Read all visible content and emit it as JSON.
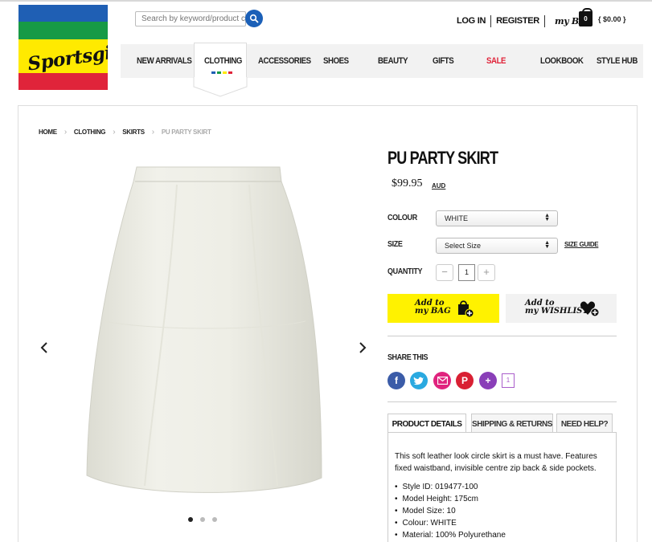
{
  "header": {
    "brand": "Sportsgirl",
    "search_placeholder": "Search by keyword/product code",
    "login": "LOG IN",
    "register": "REGISTER",
    "my_bag": "my BAG",
    "bag_count": "0",
    "bag_total": "{ $0.00 }"
  },
  "nav": {
    "items": [
      "NEW ARRIVALS",
      "CLOTHING",
      "ACCESSORIES",
      "SHOES",
      "BEAUTY",
      "GIFTS",
      "SALE",
      "LOOKBOOK",
      "STYLE HUB"
    ],
    "active": "CLOTHING",
    "sale_color": "#e0243a"
  },
  "breadcrumb": [
    "HOME",
    "CLOTHING",
    "SKIRTS",
    "PU PARTY SKIRT"
  ],
  "product": {
    "title": "PU PARTY SKIRT",
    "price": "$99.95",
    "currency": "AUD",
    "colour_label": "COLOUR",
    "colour_value": "WHITE",
    "size_label": "SIZE",
    "size_value": "Select Size",
    "size_guide": "SIZE GUIDE",
    "quantity_label": "QUANTITY",
    "quantity_value": "1",
    "qty_minus": "−",
    "qty_plus": "+",
    "add_to": "Add to",
    "bag_word": "my BAG",
    "wishlist_word": "my WISHLIST",
    "share_label": "SHARE THIS",
    "share_count": "1",
    "image_dots": 3,
    "active_dot": 0
  },
  "tabs": {
    "items": [
      "PRODUCT DETAILS",
      "SHIPPING & RETURNS",
      "NEED HELP?"
    ],
    "active": "PRODUCT DETAILS",
    "description": "This soft leather look circle skirt is a must have. Features fixed waistband, invisible centre zip back & side pockets.",
    "specs": [
      "Style ID: 019477-100",
      "Model Height: 175cm",
      "Model Size: 10",
      "Colour: WHITE",
      "Material: 100% Polyurethane"
    ]
  },
  "colors": {
    "brand_blue": "#1f5fb4",
    "brand_green": "#179a46",
    "brand_yellow": "#ffea00",
    "brand_red": "#e0243a",
    "add_to_bag_bg": "#fff200"
  }
}
